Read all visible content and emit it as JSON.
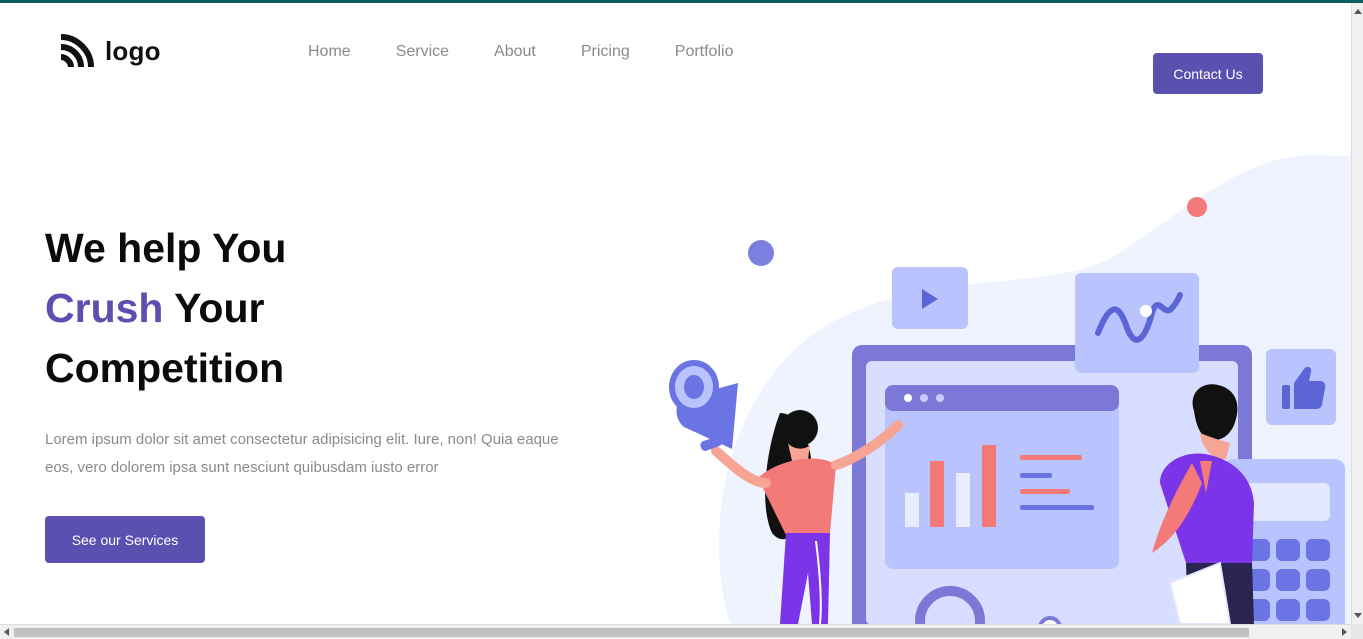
{
  "brand": {
    "logo_text": "logo",
    "logo_icon": "rss-logo-icon"
  },
  "nav": {
    "items": [
      {
        "label": "Home"
      },
      {
        "label": "Service"
      },
      {
        "label": "About"
      },
      {
        "label": "Pricing"
      },
      {
        "label": "Portfolio"
      }
    ]
  },
  "header": {
    "contact_label": "Contact Us"
  },
  "hero": {
    "title_line1": "We help You",
    "title_accent": "Crush",
    "title_line2_rest": " Your",
    "title_line3": "Competition",
    "description": "Lorem ipsum dolor sit amet consectetur adipisicing elit. Iure, non! Quia eaque eos, vero dolorem ipsa sunt nesciunt quibusdam iusto error",
    "cta_label": "See our Services"
  },
  "colors": {
    "accent": "#5b4fb0",
    "title": "#0b0b0b",
    "muted": "#8a8a8a",
    "top_border": "#0b5e5e",
    "illustration_blob": "#eef3ff",
    "illustration_purple": "#7b7fe0",
    "illustration_coral": "#f47a7a"
  },
  "illustration": {
    "icons": [
      "play-icon",
      "wave-chart-icon",
      "thumbs-up-icon",
      "megaphone-icon",
      "calculator-icon",
      "bar-chart-icon"
    ]
  }
}
